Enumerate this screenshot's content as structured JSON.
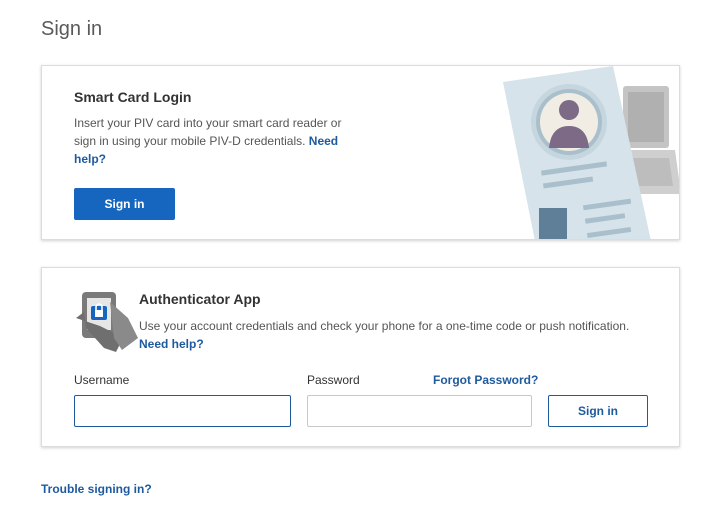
{
  "page": {
    "title": "Sign in"
  },
  "smart_card": {
    "title": "Smart Card Login",
    "description": "Insert your PIV card into your smart card reader or sign in using your mobile PIV-D credentials.",
    "help_link": "Need help?",
    "sign_in_button": "Sign in",
    "illustration_icon": "id-card-laptop-illustration"
  },
  "authenticator": {
    "icon": "phone-lock-icon",
    "title": "Authenticator App",
    "description": "Use your account credentials and check your phone for a one-time code or push notification.",
    "help_link": "Need help?",
    "username_label": "Username",
    "username_value": "",
    "password_label": "Password",
    "password_value": "",
    "forgot_link": "Forgot Password?",
    "sign_in_button": "Sign in"
  },
  "footer": {
    "trouble_link": "Trouble signing in?"
  },
  "colors": {
    "primary": "#1666c0",
    "link": "#1e5a9e",
    "illustration_card": "#d6e3ea",
    "illustration_gray": "#b9b9b9"
  }
}
